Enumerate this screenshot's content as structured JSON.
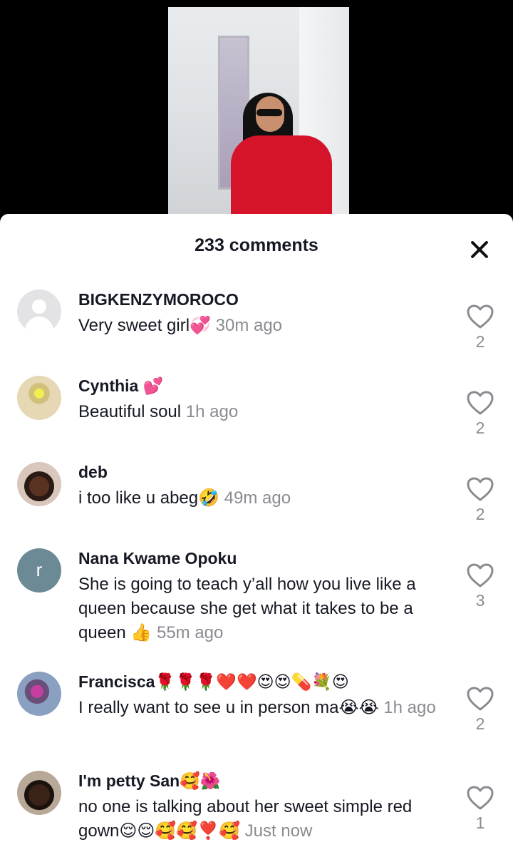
{
  "header": {
    "comment_count": "233 comments"
  },
  "comments": [
    {
      "username": "BIGKENZYMOROCO",
      "text": "Very sweet girl💞",
      "time": "30m ago",
      "likes": "2",
      "avatar": "default-avatar"
    },
    {
      "username": "Cynthia 💕",
      "text": "Beautiful soul",
      "time": "1h ago",
      "likes": "2",
      "avatar": "photo-avatar"
    },
    {
      "username": "deb",
      "text": "i too like u abeg🤣",
      "time": "49m ago",
      "likes": "2",
      "avatar": "photo-avatar"
    },
    {
      "username": "Nana Kwame Opoku",
      "avatar_letter": "r",
      "text": "She is going to teach y’all how you live like a queen because she get what it takes to be a queen 👍",
      "time": "55m ago",
      "likes": "3",
      "avatar": "letter-avatar"
    },
    {
      "username": "Francisca🌹🌹🌹❤️❤️😍😍💊💐😍",
      "text": "I really want to see u in person ma😭😭",
      "time": "1h ago",
      "likes": "2",
      "avatar": "photo-avatar"
    },
    {
      "username": "I'm petty San🥰🌺",
      "text": "no one is talking about her sweet simple red gown😌😌🥰🥰❣️🥰",
      "time": "Just now",
      "likes": "1",
      "avatar": "photo-avatar"
    }
  ],
  "icons": {
    "close": "close-icon",
    "like": "heart-outline-icon"
  }
}
